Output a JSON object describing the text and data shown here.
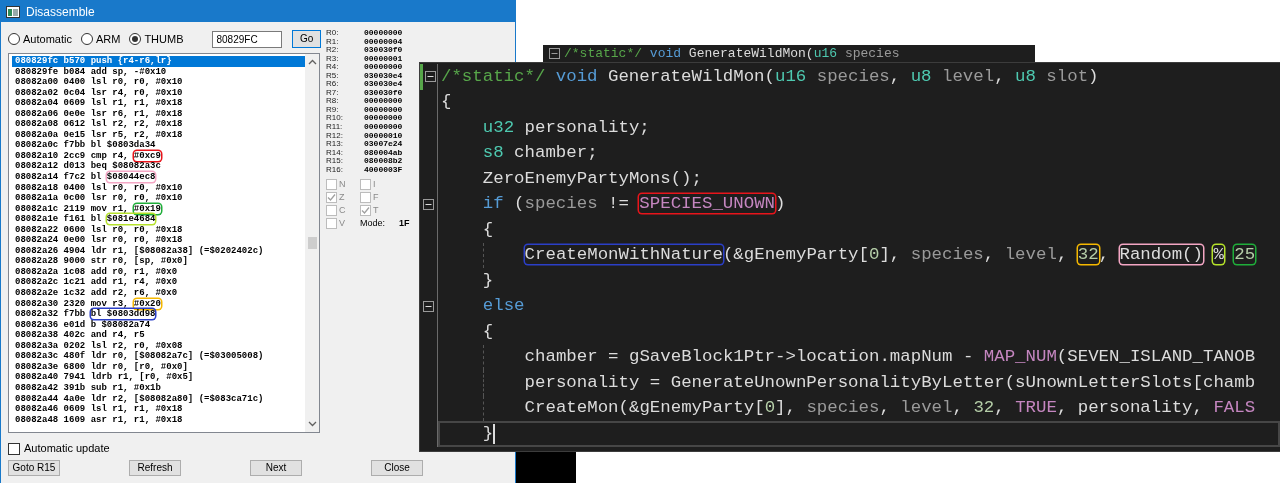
{
  "window": {
    "title": "Disassemble"
  },
  "modes": [
    {
      "label": "Automatic",
      "selected": false
    },
    {
      "label": "ARM",
      "selected": false
    },
    {
      "label": "THUMB",
      "selected": true
    }
  ],
  "address_field": {
    "value": "80829FC"
  },
  "go_button": "Go",
  "listing": [
    {
      "address": "080829fc",
      "opcode": "b570",
      "parts": [
        {
          "text": "push {r4-r6,lr}"
        }
      ],
      "selected": true
    },
    {
      "address": "080829fe",
      "opcode": "b084",
      "parts": [
        {
          "text": "add sp, -#0x10"
        }
      ],
      "selected": false
    },
    {
      "address": "08082a00",
      "opcode": "0400",
      "parts": [
        {
          "text": "lsl r0, r0, #0x10"
        }
      ],
      "selected": false
    },
    {
      "address": "08082a02",
      "opcode": "0c04",
      "parts": [
        {
          "text": "lsr r4, r0, #0x10"
        }
      ],
      "selected": false
    },
    {
      "address": "08082a04",
      "opcode": "0609",
      "parts": [
        {
          "text": "lsl r1, r1, #0x18"
        }
      ],
      "selected": false
    },
    {
      "address": "08082a06",
      "opcode": "0e0e",
      "parts": [
        {
          "text": "lsr r6, r1, #0x18"
        }
      ],
      "selected": false
    },
    {
      "address": "08082a08",
      "opcode": "0612",
      "parts": [
        {
          "text": "lsl r2, r2, #0x18"
        }
      ],
      "selected": false
    },
    {
      "address": "08082a0a",
      "opcode": "0e15",
      "parts": [
        {
          "text": "lsr r5, r2, #0x18"
        }
      ],
      "selected": false
    },
    {
      "address": "08082a0c",
      "opcode": "f7bb",
      "parts": [
        {
          "text": "bl $0803da34"
        }
      ],
      "selected": false
    },
    {
      "address": "08082a10",
      "opcode": "2cc9",
      "parts": [
        {
          "text": "cmp r4, "
        },
        {
          "text": "#0xc9",
          "color": "#e8141b"
        }
      ],
      "selected": false
    },
    {
      "address": "08082a12",
      "opcode": "d013",
      "parts": [
        {
          "text": "beq $08082a3c"
        }
      ],
      "selected": false
    },
    {
      "address": "08082a14",
      "opcode": "f7c2",
      "parts": [
        {
          "text": "bl "
        },
        {
          "text": "$08044ec8",
          "color": "#f4a6c4"
        }
      ],
      "selected": false
    },
    {
      "address": "08082a18",
      "opcode": "0400",
      "parts": [
        {
          "text": "lsl r0, r0, #0x10"
        }
      ],
      "selected": false
    },
    {
      "address": "08082a1a",
      "opcode": "0c00",
      "parts": [
        {
          "text": "lsr r0, r0, #0x10"
        }
      ],
      "selected": false
    },
    {
      "address": "08082a1c",
      "opcode": "2119",
      "parts": [
        {
          "text": "mov r1, "
        },
        {
          "text": "#0x19",
          "color": "#1fae3a"
        }
      ],
      "selected": false
    },
    {
      "address": "08082a1e",
      "opcode": "f161",
      "parts": [
        {
          "text": "bl "
        },
        {
          "text": "$081e4684",
          "color": "#b5e22a"
        }
      ],
      "selected": false
    },
    {
      "address": "08082a22",
      "opcode": "0600",
      "parts": [
        {
          "text": "lsl r0, r0, #0x18"
        }
      ],
      "selected": false
    },
    {
      "address": "08082a24",
      "opcode": "0e00",
      "parts": [
        {
          "text": "lsr r0, r0, #0x18"
        }
      ],
      "selected": false
    },
    {
      "address": "08082a26",
      "opcode": "4904",
      "parts": [
        {
          "text": "ldr r1, [$08082a38] (=$0202402c)"
        }
      ],
      "selected": false
    },
    {
      "address": "08082a28",
      "opcode": "9000",
      "parts": [
        {
          "text": "str r0, [sp, #0x0]"
        }
      ],
      "selected": false
    },
    {
      "address": "08082a2a",
      "opcode": "1c08",
      "parts": [
        {
          "text": "add r0, r1, #0x0"
        }
      ],
      "selected": false
    },
    {
      "address": "08082a2c",
      "opcode": "1c21",
      "parts": [
        {
          "text": "add r1, r4, #0x0"
        }
      ],
      "selected": false
    },
    {
      "address": "08082a2e",
      "opcode": "1c32",
      "parts": [
        {
          "text": "add r2, r6, #0x0"
        }
      ],
      "selected": false
    },
    {
      "address": "08082a30",
      "opcode": "2320",
      "parts": [
        {
          "text": "mov r3, "
        },
        {
          "text": "#0x20",
          "color": "#f5b800"
        }
      ],
      "selected": false
    },
    {
      "address": "08082a32",
      "opcode": "f7bb",
      "parts": [
        {
          "text": "bl $0803dd98",
          "color": "#2b3fc8"
        }
      ],
      "selected": false
    },
    {
      "address": "08082a36",
      "opcode": "e01d",
      "parts": [
        {
          "text": "b $08082a74"
        }
      ],
      "selected": false
    },
    {
      "address": "08082a38",
      "opcode": "402c",
      "parts": [
        {
          "text": "and r4, r5"
        }
      ],
      "selected": false
    },
    {
      "address": "08082a3a",
      "opcode": "0202",
      "parts": [
        {
          "text": "lsl r2, r0, #0x08"
        }
      ],
      "selected": false
    },
    {
      "address": "08082a3c",
      "opcode": "480f",
      "parts": [
        {
          "text": "ldr r0, [$08082a7c] (=$03005008)"
        }
      ],
      "selected": false
    },
    {
      "address": "08082a3e",
      "opcode": "6800",
      "parts": [
        {
          "text": "ldr r0, [r0, #0x0]"
        }
      ],
      "selected": false
    },
    {
      "address": "08082a40",
      "opcode": "7941",
      "parts": [
        {
          "text": "ldrb r1, [r0, #0x5]"
        }
      ],
      "selected": false
    },
    {
      "address": "08082a42",
      "opcode": "391b",
      "parts": [
        {
          "text": "sub r1, #0x1b"
        }
      ],
      "selected": false
    },
    {
      "address": "08082a44",
      "opcode": "4a0e",
      "parts": [
        {
          "text": "ldr r2, [$08082a80] (=$083ca71c)"
        }
      ],
      "selected": false
    },
    {
      "address": "08082a46",
      "opcode": "0609",
      "parts": [
        {
          "text": "lsl r1, r1, #0x18"
        }
      ],
      "selected": false
    },
    {
      "address": "08082a48",
      "opcode": "1609",
      "parts": [
        {
          "text": "asr r1, r1, #0x18"
        }
      ],
      "selected": false
    }
  ],
  "registers": [
    {
      "name": "R0:",
      "value": "00000000"
    },
    {
      "name": "R1:",
      "value": "00000004"
    },
    {
      "name": "R2:",
      "value": "030030f0"
    },
    {
      "name": "R3:",
      "value": "00000001"
    },
    {
      "name": "R4:",
      "value": "00000000"
    },
    {
      "name": "R5:",
      "value": "030030e4"
    },
    {
      "name": "R6:",
      "value": "030030e4"
    },
    {
      "name": "R7:",
      "value": "030030f0"
    },
    {
      "name": "R8:",
      "value": "00000000"
    },
    {
      "name": "R9:",
      "value": "00000000"
    },
    {
      "name": "R10:",
      "value": "00000000"
    },
    {
      "name": "R11:",
      "value": "00000000"
    },
    {
      "name": "R12:",
      "value": "00000010"
    },
    {
      "name": "R13:",
      "value": "03007e24"
    },
    {
      "name": "R14:",
      "value": "080004ab"
    },
    {
      "name": "R15:",
      "value": "080008b2"
    },
    {
      "name": "R16:",
      "value": "4000003F"
    }
  ],
  "flags": [
    {
      "label": "N",
      "checked": false,
      "disabled": true
    },
    {
      "label": "Z",
      "checked": true,
      "disabled": true
    },
    {
      "label": "C",
      "checked": false,
      "disabled": true
    },
    {
      "label": "V",
      "checked": false,
      "disabled": true
    },
    {
      "label": "I",
      "checked": false,
      "disabled": true
    },
    {
      "label": "F",
      "checked": false,
      "disabled": true
    },
    {
      "label": "T",
      "checked": true,
      "disabled": true
    }
  ],
  "mode": {
    "label": "Mode:",
    "value": "1F"
  },
  "automatic_update": {
    "label": "Automatic update",
    "checked": false
  },
  "buttons": [
    "Goto R15",
    "Refresh",
    "Next",
    "Close"
  ],
  "back_editor": {
    "tokens": [
      {
        "text": "/*static*/ ",
        "kind": "comment"
      },
      {
        "text": "void",
        "kind": "keyword"
      },
      {
        "text": " GenerateWildMon(",
        "kind": "plain"
      },
      {
        "text": "u16",
        "kind": "type"
      },
      {
        "text": " species",
        "kind": "param"
      }
    ]
  },
  "editor": {
    "lines": [
      {
        "fold": true,
        "current": false,
        "tokens": [
          {
            "text": "/*static*/ ",
            "kind": "comment"
          },
          {
            "text": "void",
            "kind": "keyword"
          },
          {
            "text": " GenerateWildMon(",
            "kind": "plain"
          },
          {
            "text": "u16",
            "kind": "type"
          },
          {
            "text": " species",
            "kind": "param"
          },
          {
            "text": ", ",
            "kind": "plain"
          },
          {
            "text": "u8",
            "kind": "type"
          },
          {
            "text": " level",
            "kind": "param"
          },
          {
            "text": ", ",
            "kind": "plain"
          },
          {
            "text": "u8",
            "kind": "type"
          },
          {
            "text": " slot",
            "kind": "param"
          },
          {
            "text": ")",
            "kind": "plain"
          }
        ]
      },
      {
        "fold": false,
        "current": false,
        "tokens": [
          {
            "text": "{",
            "kind": "plain"
          }
        ],
        "children": [
          {
            "fold": false,
            "current": false,
            "tokens": [
              {
                "text": "u32",
                "kind": "type"
              },
              {
                "text": " personality;",
                "kind": "plain"
              }
            ]
          },
          {
            "fold": false,
            "current": false,
            "tokens": [
              {
                "text": "s8",
                "kind": "type"
              },
              {
                "text": " chamber;",
                "kind": "plain"
              }
            ]
          },
          {
            "fold": false,
            "current": false,
            "tokens": [
              {
                "text": "ZeroEnemyPartyMons();",
                "kind": "plain"
              }
            ]
          },
          {
            "fold": true,
            "current": false,
            "tokens": [
              {
                "text": "if",
                "kind": "keyword"
              },
              {
                "text": " (",
                "kind": "plain"
              },
              {
                "text": "species",
                "kind": "param"
              },
              {
                "text": " != ",
                "kind": "plain"
              },
              {
                "text": "SPECIES_UNOWN",
                "kind": "macro",
                "color": "#e8141b"
              },
              {
                "text": ")",
                "kind": "plain"
              }
            ]
          },
          {
            "fold": false,
            "current": false,
            "tokens": [
              {
                "text": "{",
                "kind": "plain"
              }
            ],
            "children": [
              {
                "fold": false,
                "current": false,
                "tokens": [
                  {
                    "text": "CreateMonWithNature",
                    "kind": "plain",
                    "color": "#2b3fc8"
                  },
                  {
                    "text": "(&gEnemyParty[",
                    "kind": "plain"
                  },
                  {
                    "text": "0",
                    "kind": "number"
                  },
                  {
                    "text": "], ",
                    "kind": "plain"
                  },
                  {
                    "text": "species",
                    "kind": "param"
                  },
                  {
                    "text": ", ",
                    "kind": "plain"
                  },
                  {
                    "text": "level",
                    "kind": "param"
                  },
                  {
                    "text": ", ",
                    "kind": "plain"
                  },
                  {
                    "text": "32",
                    "kind": "number",
                    "color": "#f5b800"
                  },
                  {
                    "text": ", ",
                    "kind": "plain"
                  },
                  {
                    "text": "Random() ",
                    "kind": "plain",
                    "color": "#f4a6c4"
                  },
                  {
                    "text": "% ",
                    "kind": "plain",
                    "color": "#b5e22a"
                  },
                  {
                    "text": "25",
                    "kind": "number",
                    "color": "#1fae3a"
                  }
                ]
              }
            ]
          },
          {
            "fold": false,
            "current": false,
            "tokens": [
              {
                "text": "}",
                "kind": "plain"
              }
            ]
          },
          {
            "fold": true,
            "current": false,
            "tokens": [
              {
                "text": "else",
                "kind": "keyword"
              }
            ]
          },
          {
            "fold": false,
            "current": false,
            "tokens": [
              {
                "text": "{",
                "kind": "plain"
              }
            ],
            "children": [
              {
                "fold": false,
                "current": false,
                "tokens": [
                  {
                    "text": "chamber = gSaveBlock1Ptr->location.mapNum - ",
                    "kind": "plain"
                  },
                  {
                    "text": "MAP_NUM",
                    "kind": "macro"
                  },
                  {
                    "text": "(SEVEN_ISLAND_TANOB",
                    "kind": "plain"
                  }
                ]
              },
              {
                "fold": false,
                "current": false,
                "tokens": [
                  {
                    "text": "personality = GenerateUnownPersonalityByLetter(sUnownLetterSlots[chamb",
                    "kind": "plain"
                  }
                ]
              },
              {
                "fold": false,
                "current": false,
                "tokens": [
                  {
                    "text": "CreateMon(&gEnemyParty[",
                    "kind": "plain"
                  },
                  {
                    "text": "0",
                    "kind": "number"
                  },
                  {
                    "text": "], ",
                    "kind": "plain"
                  },
                  {
                    "text": "species",
                    "kind": "param"
                  },
                  {
                    "text": ", ",
                    "kind": "plain"
                  },
                  {
                    "text": "level",
                    "kind": "param"
                  },
                  {
                    "text": ", ",
                    "kind": "plain"
                  },
                  {
                    "text": "32",
                    "kind": "number"
                  },
                  {
                    "text": ", ",
                    "kind": "plain"
                  },
                  {
                    "text": "TRUE",
                    "kind": "macro"
                  },
                  {
                    "text": ", personality, ",
                    "kind": "plain"
                  },
                  {
                    "text": "FALS",
                    "kind": "macro"
                  }
                ]
              }
            ]
          },
          {
            "fold": false,
            "current": true,
            "tokens": [
              {
                "text": "}",
                "kind": "plain"
              }
            ]
          }
        ]
      }
    ]
  }
}
